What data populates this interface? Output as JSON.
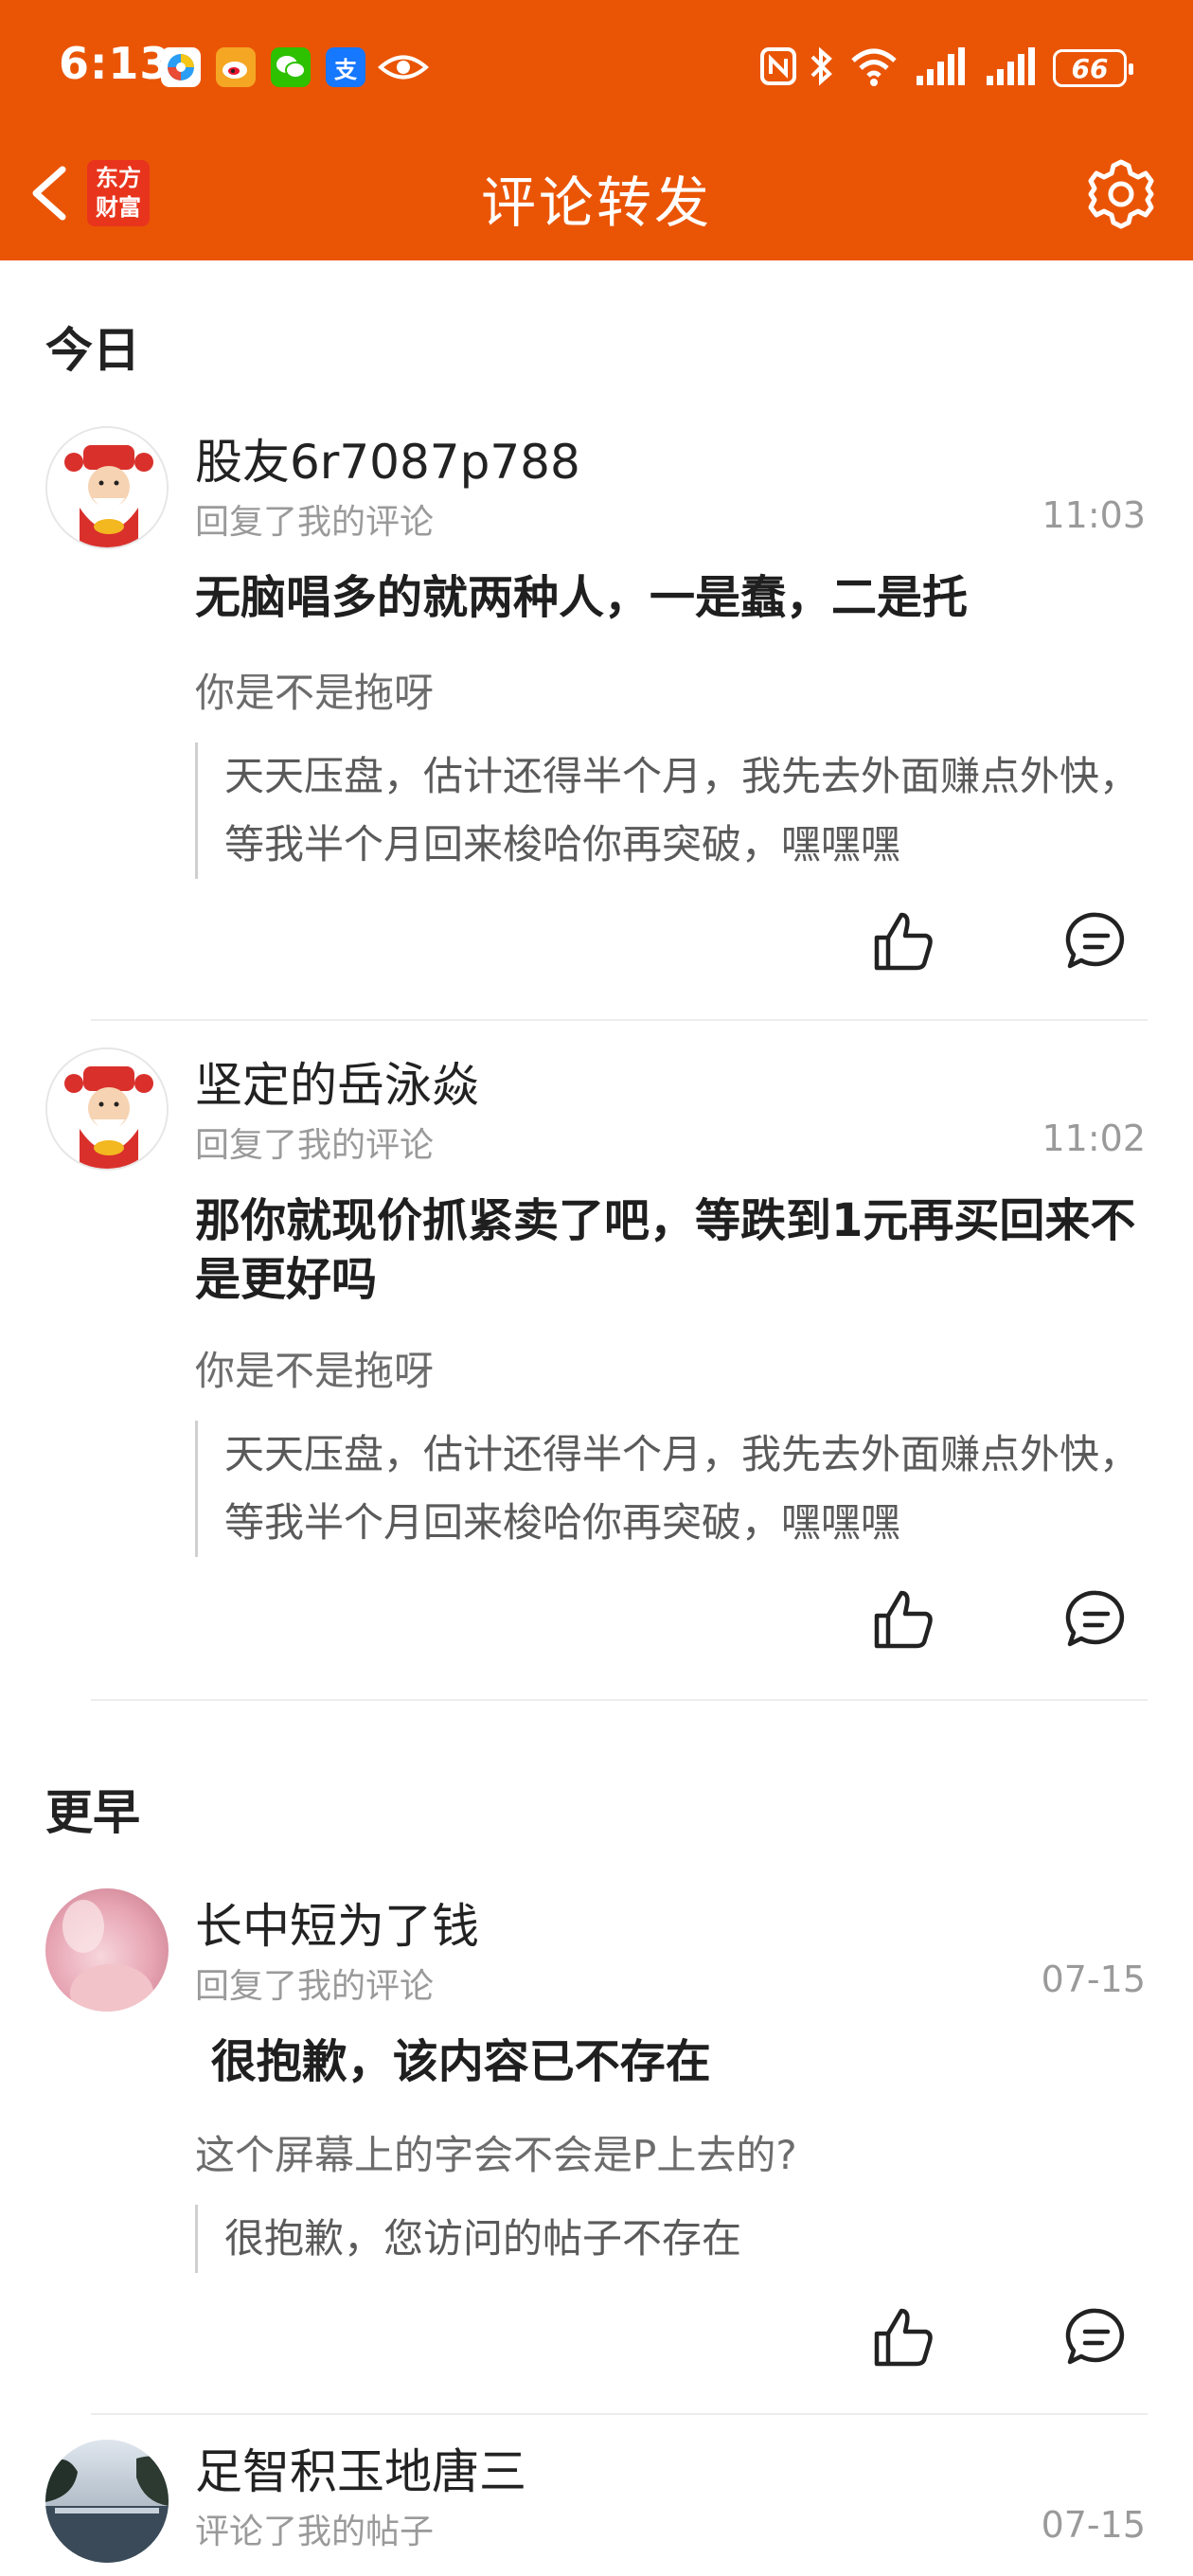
{
  "status_bar": {
    "time": "6:13",
    "battery": "66",
    "app_icons": [
      "browser-app-icon",
      "weibo-icon",
      "wechat-icon",
      "alipay-icon",
      "eye-icon"
    ],
    "right_icons": [
      "nfc-icon",
      "bluetooth-icon",
      "wifi-icon",
      "signal-icon",
      "signal-icon",
      "battery-icon"
    ],
    "alipay_glyph": "支"
  },
  "header": {
    "title": "评论转发",
    "logo_line1": "东方",
    "logo_line2": "财富",
    "back_icon": "chevron-left-icon",
    "settings_icon": "gear-icon",
    "bg_color": "#ea5505"
  },
  "sections": [
    {
      "title": "今日",
      "items": [
        {
          "username": "股友6r7087p788",
          "action": "回复了我的评论",
          "time": "11:03",
          "reply": "无脑唱多的就两种人，一是蠢，二是托",
          "my_comment": "你是不是拖呀",
          "quote": "天天压盘，估计还得半个月，我先去外面赚点外快，等我半个月回来梭哈你再突破，嘿嘿嘿"
        },
        {
          "username": "坚定的岳泳焱",
          "action": "回复了我的评论",
          "time": "11:02",
          "reply": "那你就现价抓紧卖了吧，等跌到1元再买回来不是更好吗",
          "my_comment": "你是不是拖呀",
          "quote": "天天压盘，估计还得半个月，我先去外面赚点外快，等我半个月回来梭哈你再突破，嘿嘿嘿"
        }
      ]
    },
    {
      "title": "更早",
      "items": [
        {
          "username": "长中短为了钱",
          "action": "回复了我的评论",
          "time": "07-15",
          "reply": " 很抱歉，该内容已不存在",
          "my_comment": "这个屏幕上的字会不会是P上去的?",
          "quote": "很抱歉，您访问的帖子不存在"
        },
        {
          "username": "足智积玉地唐三",
          "action": "评论了我的帖子",
          "time": "07-15"
        }
      ]
    }
  ]
}
